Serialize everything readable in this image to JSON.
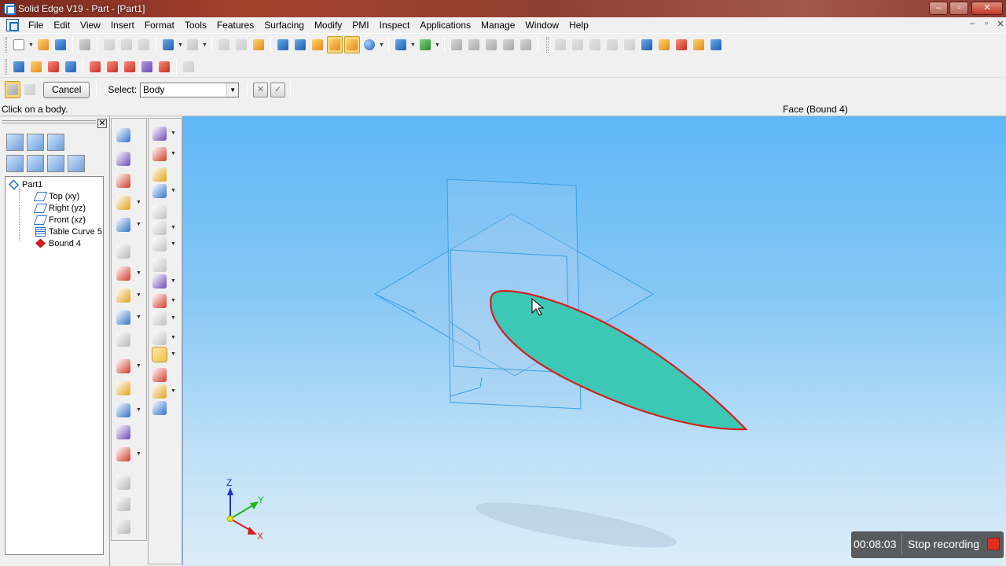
{
  "window": {
    "title": "Solid Edge V19 - Part - [Part1]"
  },
  "menu": [
    "File",
    "Edit",
    "View",
    "Insert",
    "Format",
    "Tools",
    "Features",
    "Surfacing",
    "Modify",
    "PMI",
    "Inspect",
    "Applications",
    "Manage",
    "Window",
    "Help"
  ],
  "command_bar": {
    "cancel_label": "Cancel",
    "select_label": "Select:",
    "select_value": "Body"
  },
  "status": {
    "prompt": "Click on a body.",
    "hover_info": "Face (Bound 4)"
  },
  "tree": {
    "root": "Part1",
    "items": [
      {
        "label": "Top (xy)",
        "icon": "plane-icon"
      },
      {
        "label": "Right (yz)",
        "icon": "plane-icon"
      },
      {
        "label": "Front (xz)",
        "icon": "plane-icon"
      },
      {
        "label": "Table Curve 5",
        "icon": "table-curve-icon"
      },
      {
        "label": "Bound 4",
        "icon": "bounded-surface-icon"
      }
    ]
  },
  "triad": {
    "z": "Z",
    "y": "Y",
    "x": "X"
  },
  "recording": {
    "time": "00:08:03",
    "stop_label": "Stop recording"
  },
  "colors": {
    "viewport_top": "#5fb7f6",
    "viewport_bottom": "#dcedf8",
    "surface_fill": "#3cc8b4",
    "surface_edge": "#d42020",
    "planes": "#3aa0e0"
  }
}
